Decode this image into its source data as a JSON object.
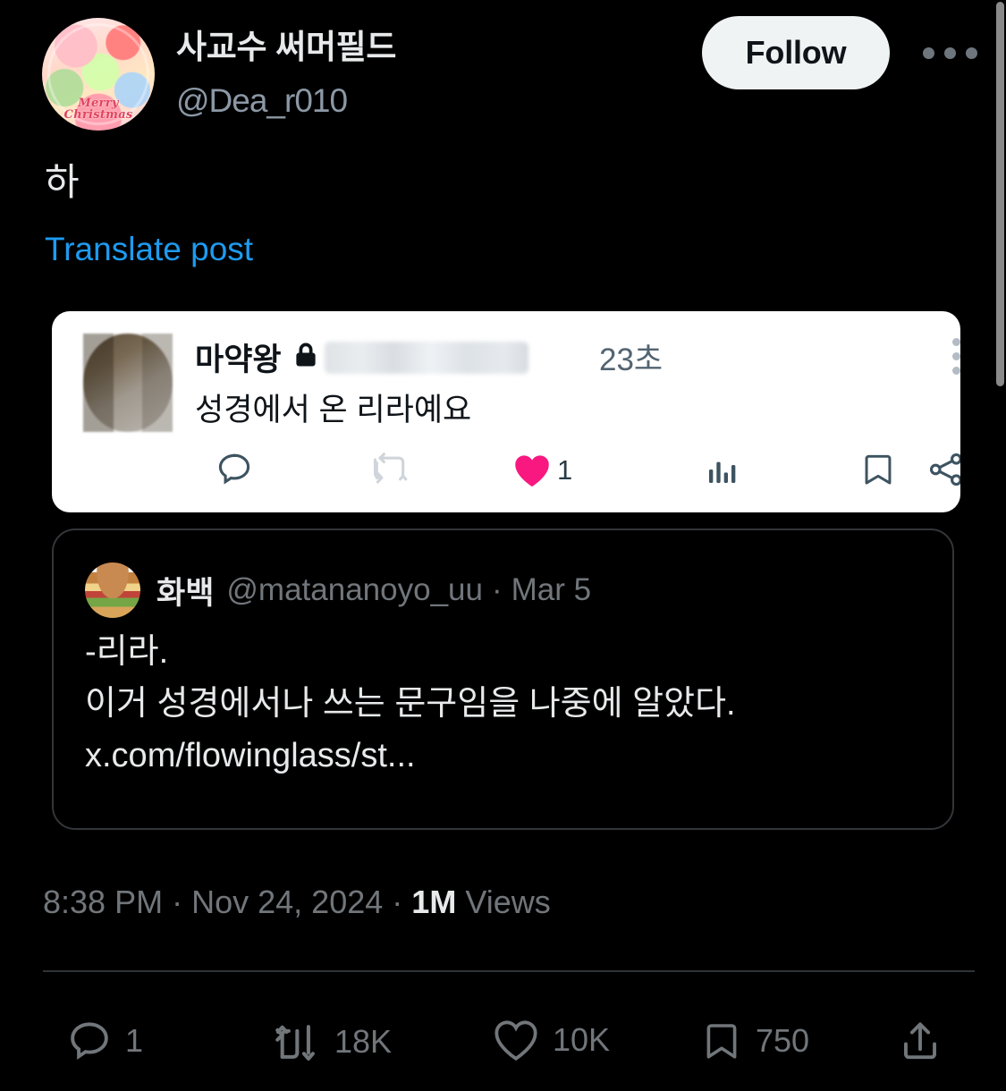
{
  "account": {
    "display_name": "사교수 써머필드",
    "handle": "@Dea_r010",
    "avatar_icon": "christmas-illustration-avatar",
    "avatar_caption": "Merry Christmas",
    "follow_label": "Follow",
    "more_icon": "more-horizontal-icon"
  },
  "post": {
    "text": "하",
    "translate_label": "Translate post"
  },
  "embedded_screenshot": {
    "name": "마약왕",
    "lock_icon": "lock-icon",
    "handle_redacted": "",
    "timestamp": "23초",
    "menu_icon": "more-vertical-icon",
    "body": "성경에서 온 리라예요",
    "actions": [
      {
        "icon": "reply-icon",
        "count": ""
      },
      {
        "icon": "retweet-icon",
        "count": ""
      },
      {
        "icon": "heart-filled-icon",
        "count": "1"
      },
      {
        "icon": "analytics-icon",
        "count": ""
      },
      {
        "icon": "bookmark-icon",
        "count": ""
      },
      {
        "icon": "share-icon",
        "count": ""
      }
    ]
  },
  "quoted_post": {
    "avatar_icon": "hamburger-avatar",
    "name": "화백",
    "handle": "@matananoyo_uu",
    "separator": "·",
    "date": "Mar 5",
    "lines": [
      "-리라.",
      "이거 성경에서나 쓰는 문구임을 나중에 알았다.",
      "x.com/flowinglass/st..."
    ]
  },
  "meta": {
    "time": "8:38 PM",
    "sep1": "·",
    "date": "Nov 24, 2024",
    "sep2": "·",
    "views_count": "1M",
    "views_label": "Views"
  },
  "engagement": [
    {
      "icon": "reply-icon",
      "count": "1"
    },
    {
      "icon": "retweet-icon",
      "count": "18K"
    },
    {
      "icon": "heart-icon",
      "count": "10K"
    },
    {
      "icon": "bookmark-icon",
      "count": "750"
    },
    {
      "icon": "share-icon",
      "count": ""
    }
  ],
  "colors": {
    "background": "#000000",
    "primary_text": "#e7e9ea",
    "secondary_text": "#71767b",
    "link_blue": "#1d9bf0",
    "heart_pink": "#f91880",
    "follow_bg": "#eff3f4",
    "card_white": "#ffffff",
    "border": "#333639"
  }
}
